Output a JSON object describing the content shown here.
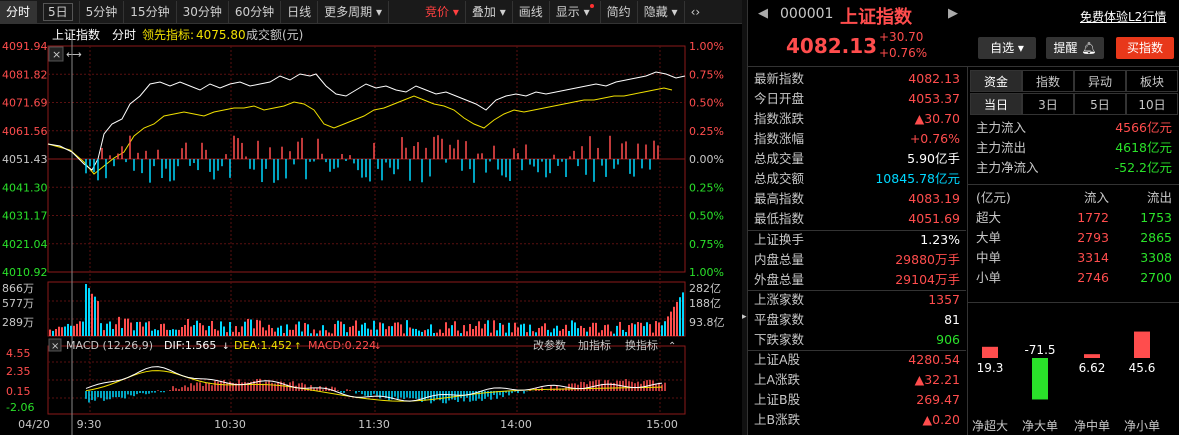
{
  "toolbar": {
    "items": [
      "分时",
      "5日",
      "5分钟",
      "15分钟",
      "30分钟",
      "60分钟",
      "日线",
      "更多周期",
      "竞价",
      "叠加",
      "画线",
      "显示",
      "简约",
      "隐藏"
    ],
    "icon_collapse": "‹›"
  },
  "chart": {
    "title": "上证指数",
    "mode": "分时",
    "lead_label": "领先指标:",
    "lead_value": "4075.80",
    "turnover_label": "成交额(元)",
    "price_ticks": [
      "4091.94",
      "4081.82",
      "4071.69",
      "4061.56",
      "4051.43",
      "4041.30",
      "4031.17",
      "4021.04",
      "4010.92"
    ],
    "pct_ticks": [
      "1.00%",
      "0.75%",
      "0.50%",
      "0.25%",
      "0.00%",
      "0.25%",
      "0.50%",
      "0.75%",
      "1.00%"
    ],
    "vol_left_ticks": [
      "866万",
      "577万",
      "289万"
    ],
    "vol_right_ticks": [
      "282亿",
      "188亿",
      "93.8亿"
    ],
    "macd_title": "MACD (12,26,9)",
    "dif": "DIF:1.565",
    "dea": "DEA:1.452",
    "macd": "MACD:0.224",
    "macd_ticks": [
      "4.55",
      "2.35",
      "0.15",
      "-2.06"
    ],
    "macd_links": [
      "改参数",
      "加指标",
      "换指标"
    ],
    "time_labels": [
      "04/20",
      "9:30",
      "10:30",
      "11:30",
      "14:00",
      "15:00"
    ]
  },
  "quote": {
    "code": "000001",
    "name": "上证指数",
    "promo": "免费体验L2行情",
    "price": "4082.13",
    "change": "+30.70",
    "change_pct": "+0.76%",
    "btn_watch": "自选",
    "btn_alert": "提醒",
    "btn_buy": "买指数",
    "rows1": [
      {
        "label": "最新指数",
        "value": "4082.13"
      },
      {
        "label": "今日开盘",
        "value": "4053.37"
      },
      {
        "label": "指数涨跌",
        "value": "▲30.70"
      },
      {
        "label": "指数涨幅",
        "value": "+0.76%"
      },
      {
        "label": "总成交量",
        "value": "5.90亿手"
      },
      {
        "label": "总成交额",
        "value": "10845.78亿元"
      },
      {
        "label": "最高指数",
        "value": "4083.19"
      },
      {
        "label": "最低指数",
        "value": "4051.69"
      }
    ],
    "rows2": [
      {
        "label": "上证换手",
        "value": "1.23%"
      },
      {
        "label": "内盘总量",
        "value": "29880万手"
      },
      {
        "label": "外盘总量",
        "value": "29104万手"
      }
    ],
    "rows3": [
      {
        "label": "上涨家数",
        "value": "1357"
      },
      {
        "label": "平盘家数",
        "value": "81"
      },
      {
        "label": "下跌家数",
        "value": "906"
      }
    ],
    "rows4": [
      {
        "label": "上证A股",
        "value": "4280.54"
      },
      {
        "label": "上A涨跌",
        "value": "▲32.21"
      },
      {
        "label": "上证B股",
        "value": "269.47"
      },
      {
        "label": "上B涨跌",
        "value": "▲0.20"
      }
    ]
  },
  "flow": {
    "tabs": [
      "资金",
      "指数",
      "异动",
      "板块"
    ],
    "periods": [
      "当日",
      "3日",
      "5日",
      "10日"
    ],
    "main_in_label": "主力流入",
    "main_in": "4566亿元",
    "main_out_label": "主力流出",
    "main_out": "4618亿元",
    "main_net_label": "主力净流入",
    "main_net": "-52.2亿元",
    "head": [
      "(亿元)",
      "流入",
      "流出"
    ],
    "rows": [
      {
        "label": "超大",
        "in": "1772",
        "out": "1753"
      },
      {
        "label": "大单",
        "in": "2793",
        "out": "2865"
      },
      {
        "label": "中单",
        "in": "3314",
        "out": "3308"
      },
      {
        "label": "小单",
        "in": "2746",
        "out": "2700"
      }
    ],
    "bars": [
      {
        "label": "净超大",
        "value": 19.3,
        "text": "19.3"
      },
      {
        "label": "净大单",
        "value": -71.5,
        "text": "-71.5"
      },
      {
        "label": "净中单",
        "value": 6.62,
        "text": "6.62"
      },
      {
        "label": "净小单",
        "value": 45.6,
        "text": "45.6"
      }
    ]
  }
}
